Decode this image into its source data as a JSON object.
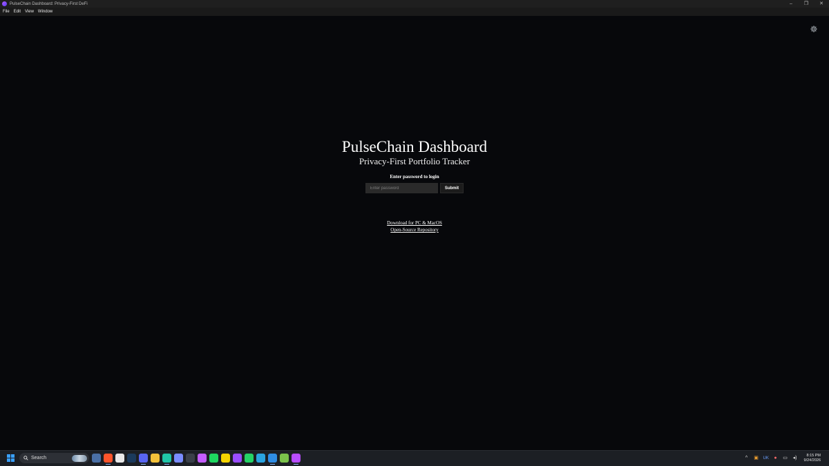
{
  "window": {
    "title": "PulseChain Dashboard: Privacy-First DeFi",
    "controls": {
      "minimize": "–",
      "restore": "❐",
      "close": "✕"
    }
  },
  "menu": [
    "File",
    "Edit",
    "View",
    "Window"
  ],
  "main": {
    "title": "PulseChain Dashboard",
    "subtitle": "Privacy-First Portfolio Tracker",
    "prompt": "Enter password to login",
    "password_placeholder": "Enter password",
    "password_value": "",
    "submit_label": "Submit",
    "links": {
      "download": "Download for PC & MacOS",
      "repo": "Open-Source Repository"
    },
    "settings_icon": "gear-icon"
  },
  "taskbar": {
    "search_label": "Search",
    "apps": [
      {
        "icon": "calculator-icon",
        "color": "#4a6fa5"
      },
      {
        "icon": "brave-browser-icon",
        "color": "#fb542b"
      },
      {
        "icon": "messenger-icon",
        "color": "#e9e9e9"
      },
      {
        "icon": "steam-icon",
        "color": "#1b3a5c"
      },
      {
        "icon": "discord-icon",
        "color": "#5865f2"
      },
      {
        "icon": "file-explorer-icon",
        "color": "#f3c13a"
      },
      {
        "icon": "app-icon",
        "color": "#20c5a8"
      },
      {
        "icon": "app-icon",
        "color": "#7a8cff"
      },
      {
        "icon": "app-icon",
        "color": "#3a3f48"
      },
      {
        "icon": "app-icon",
        "color": "#c45cff"
      },
      {
        "icon": "spotify-icon",
        "color": "#1ed760"
      },
      {
        "icon": "app-icon",
        "color": "#f5d400"
      },
      {
        "icon": "app-icon",
        "color": "#9a4dff"
      },
      {
        "icon": "whatsapp-icon",
        "color": "#25d366"
      },
      {
        "icon": "telegram-icon",
        "color": "#2aa3e0"
      },
      {
        "icon": "vscode-icon",
        "color": "#2f8de4"
      },
      {
        "icon": "app-icon",
        "color": "#7bc24b"
      },
      {
        "icon": "app-icon",
        "color": "#b84dff"
      }
    ],
    "tray": {
      "chevron": "^",
      "keyboard": "UK",
      "date_time": {
        "time": "8:15 PM",
        "date": "9/24/2026"
      }
    }
  }
}
